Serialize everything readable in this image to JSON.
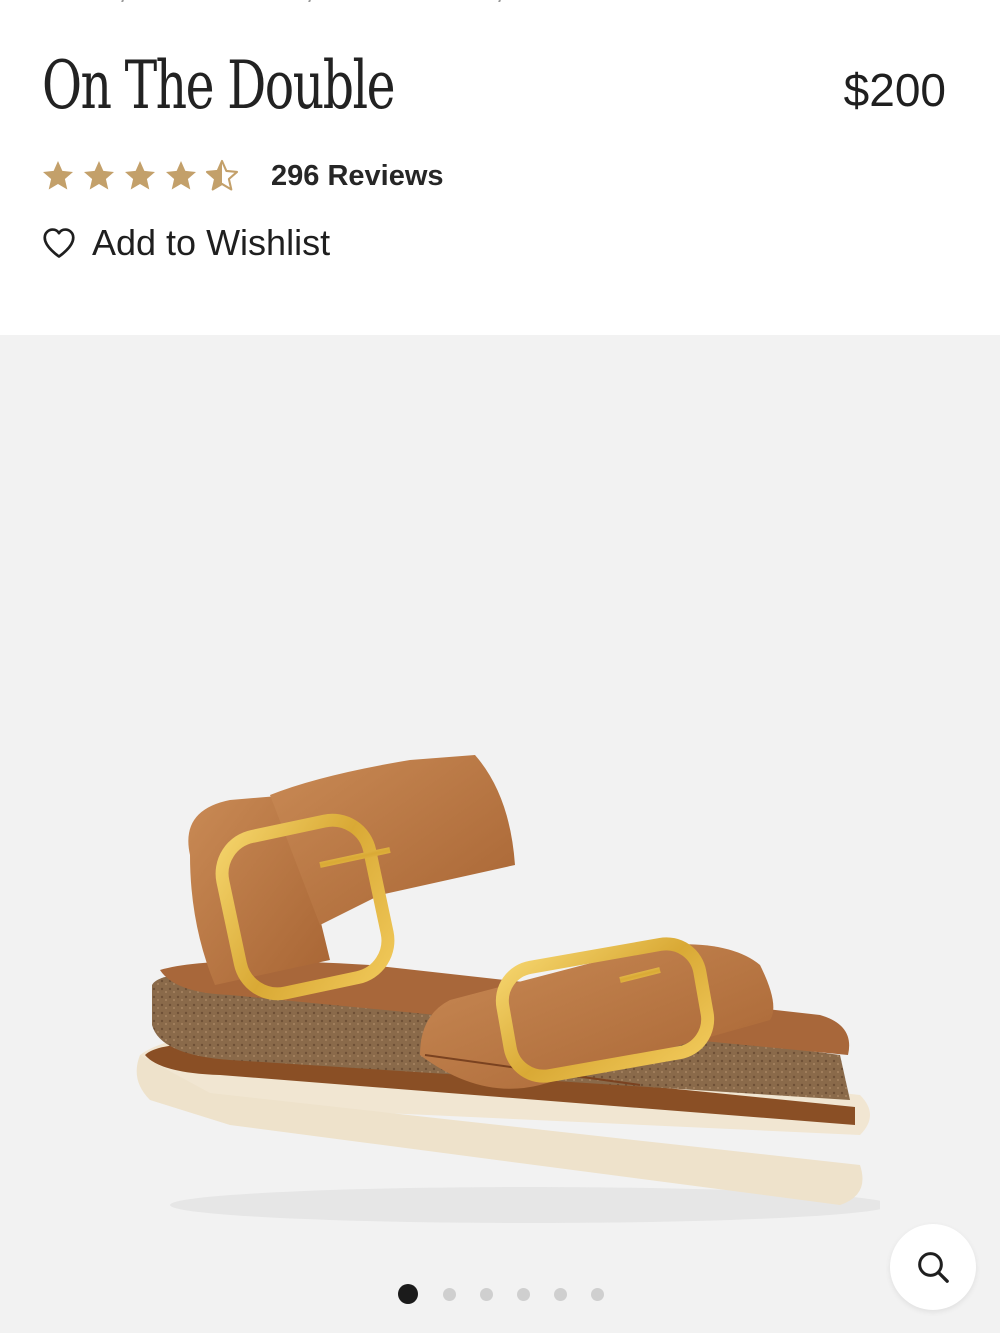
{
  "product": {
    "title": "On The Double",
    "price": "$200",
    "rating": 4.5,
    "rating_max": 5,
    "star_color": "#c3a06a",
    "reviews_label": "296 Reviews",
    "wishlist_label": "Add to Wishlist"
  },
  "gallery": {
    "image_count": 6,
    "active_index": 0,
    "background": "#f2f2f2",
    "zoom_icon": "search-icon",
    "image_name": "sandal-product-image"
  }
}
